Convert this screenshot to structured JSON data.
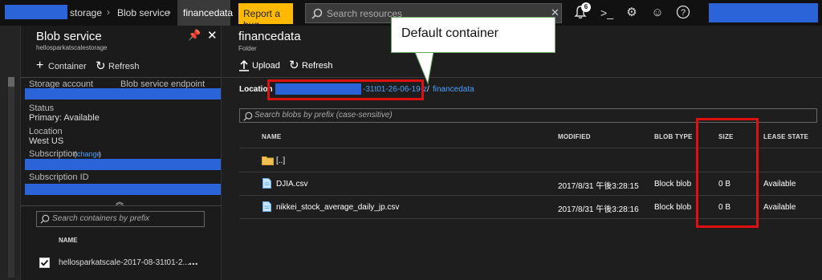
{
  "topbar": {
    "breadcrumb": [
      "storage",
      "Blob service",
      "financedata"
    ],
    "report_bug": "Report a bug",
    "search_placeholder": "Search resources",
    "notification_count": "6"
  },
  "blob_service": {
    "title": "Blob service",
    "subtitle": "hellosparkatscalestorage",
    "container_btn": "Container",
    "refresh_btn": "Refresh",
    "storage_account_label": "Storage account",
    "endpoint_label": "Blob service endpoint",
    "status_label": "Status",
    "status_value": "Primary: Available",
    "location_label": "Location",
    "location_value": "West US",
    "subscription_label": "Subscription",
    "subscription_change": "change",
    "subscription_id_label": "Subscription ID",
    "search_placeholder": "Search containers by prefix",
    "name_header": "NAME",
    "container_item": "hellosparkatscale-2017-08-31t01-2...",
    "more": "..."
  },
  "financedata": {
    "title": "financedata",
    "subtitle": "Folder",
    "upload_btn": "Upload",
    "refresh_btn": "Refresh",
    "location_label": "Location :",
    "location_suffix": "-31t01-26-06-19-z",
    "location_sep": "/",
    "location_link": "financedata",
    "search_placeholder": "Search blobs by prefix (case-sensitive)",
    "columns": [
      "NAME",
      "MODIFIED",
      "BLOB TYPE",
      "SIZE",
      "LEASE STATE"
    ],
    "rows": [
      {
        "name": "[..]",
        "modified": "",
        "type": "",
        "size": "",
        "lease": ""
      },
      {
        "name": "DJIA.csv",
        "modified": "2017/8/31 午後3:28:15",
        "type": "Block blob",
        "size": "0 B",
        "lease": "Available"
      },
      {
        "name": "nikkei_stock_average_daily_jp.csv",
        "modified": "2017/8/31 午後3:28:16",
        "type": "Block blob",
        "size": "0 B",
        "lease": "Available"
      }
    ]
  },
  "callout": {
    "text": "Default container"
  },
  "colors": {
    "accent_yellow": "#ffb900",
    "redaction": "#2b64d8",
    "highlight_red": "#e01010",
    "link_blue": "#4aa0ff"
  }
}
